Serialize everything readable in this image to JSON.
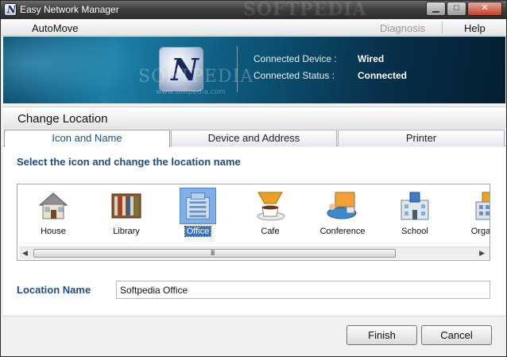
{
  "window": {
    "title": "Easy Network Manager",
    "watermark": "SOFTPEDIA",
    "controls": {
      "minimize": "▁",
      "maximize": "□",
      "close": "✕"
    }
  },
  "menu": {
    "automove": "AutoMove",
    "diagnosis": "Diagnosis",
    "help": "Help"
  },
  "banner": {
    "watermark": "SOFTPEDIA",
    "watermark_sub": "www.softpedia.com",
    "device_label": "Connected Device :",
    "device_value": "Wired",
    "status_label": "Connected Status :",
    "status_value": "Connected"
  },
  "section": {
    "title": "Change Location"
  },
  "tabs": [
    {
      "label": "Icon and Name",
      "active": true
    },
    {
      "label": "Device and Address",
      "active": false
    },
    {
      "label": "Printer",
      "active": false
    }
  ],
  "panel": {
    "instruction": "Select the icon and change the location name",
    "icons": [
      {
        "label": "House",
        "icon": "house-icon"
      },
      {
        "label": "Library",
        "icon": "library-icon"
      },
      {
        "label": "Office",
        "icon": "office-icon",
        "selected": true
      },
      {
        "label": "Cafe",
        "icon": "cafe-icon"
      },
      {
        "label": "Conference",
        "icon": "conference-icon"
      },
      {
        "label": "School",
        "icon": "school-icon"
      },
      {
        "label": "Organiz",
        "icon": "organization-icon"
      }
    ],
    "scroll_grip": "III",
    "location_label": "Location Name",
    "location_value": "Softpedia Office"
  },
  "buttons": {
    "finish": "Finish",
    "cancel": "Cancel"
  }
}
